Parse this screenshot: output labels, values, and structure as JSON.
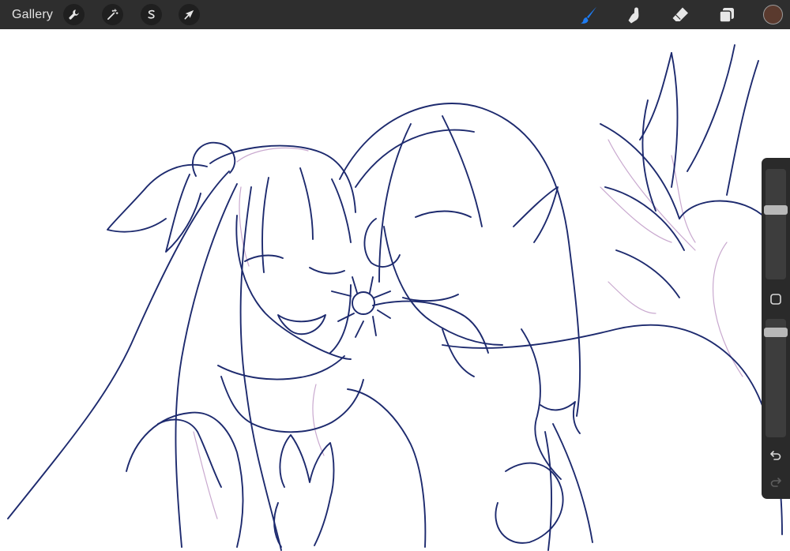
{
  "topbar": {
    "gallery_label": "Gallery",
    "left_tools": [
      {
        "name": "actions",
        "icon": "wrench-icon"
      },
      {
        "name": "adjustments",
        "icon": "magic-wand-icon"
      },
      {
        "name": "selection",
        "icon": "selection-s-icon"
      },
      {
        "name": "transform",
        "icon": "arrow-cursor-icon"
      }
    ],
    "right_tools": [
      {
        "name": "brush",
        "icon": "brush-icon",
        "active": true
      },
      {
        "name": "smudge",
        "icon": "smudge-finger-icon",
        "active": false
      },
      {
        "name": "eraser",
        "icon": "eraser-icon",
        "active": false
      },
      {
        "name": "layers",
        "icon": "layers-icon",
        "active": false
      }
    ],
    "current_color": "#5a3a2e"
  },
  "colors": {
    "topbar_bg": "#2e2e2e",
    "active_tool": "#1e7cf2",
    "line_art": "#1d2a6e",
    "sketch": "#c9a9cf"
  },
  "sidebar": {
    "brush_size": 0.64,
    "opacity": 0.92,
    "icons": [
      "square-icon",
      "undo-icon",
      "redo-icon"
    ]
  }
}
